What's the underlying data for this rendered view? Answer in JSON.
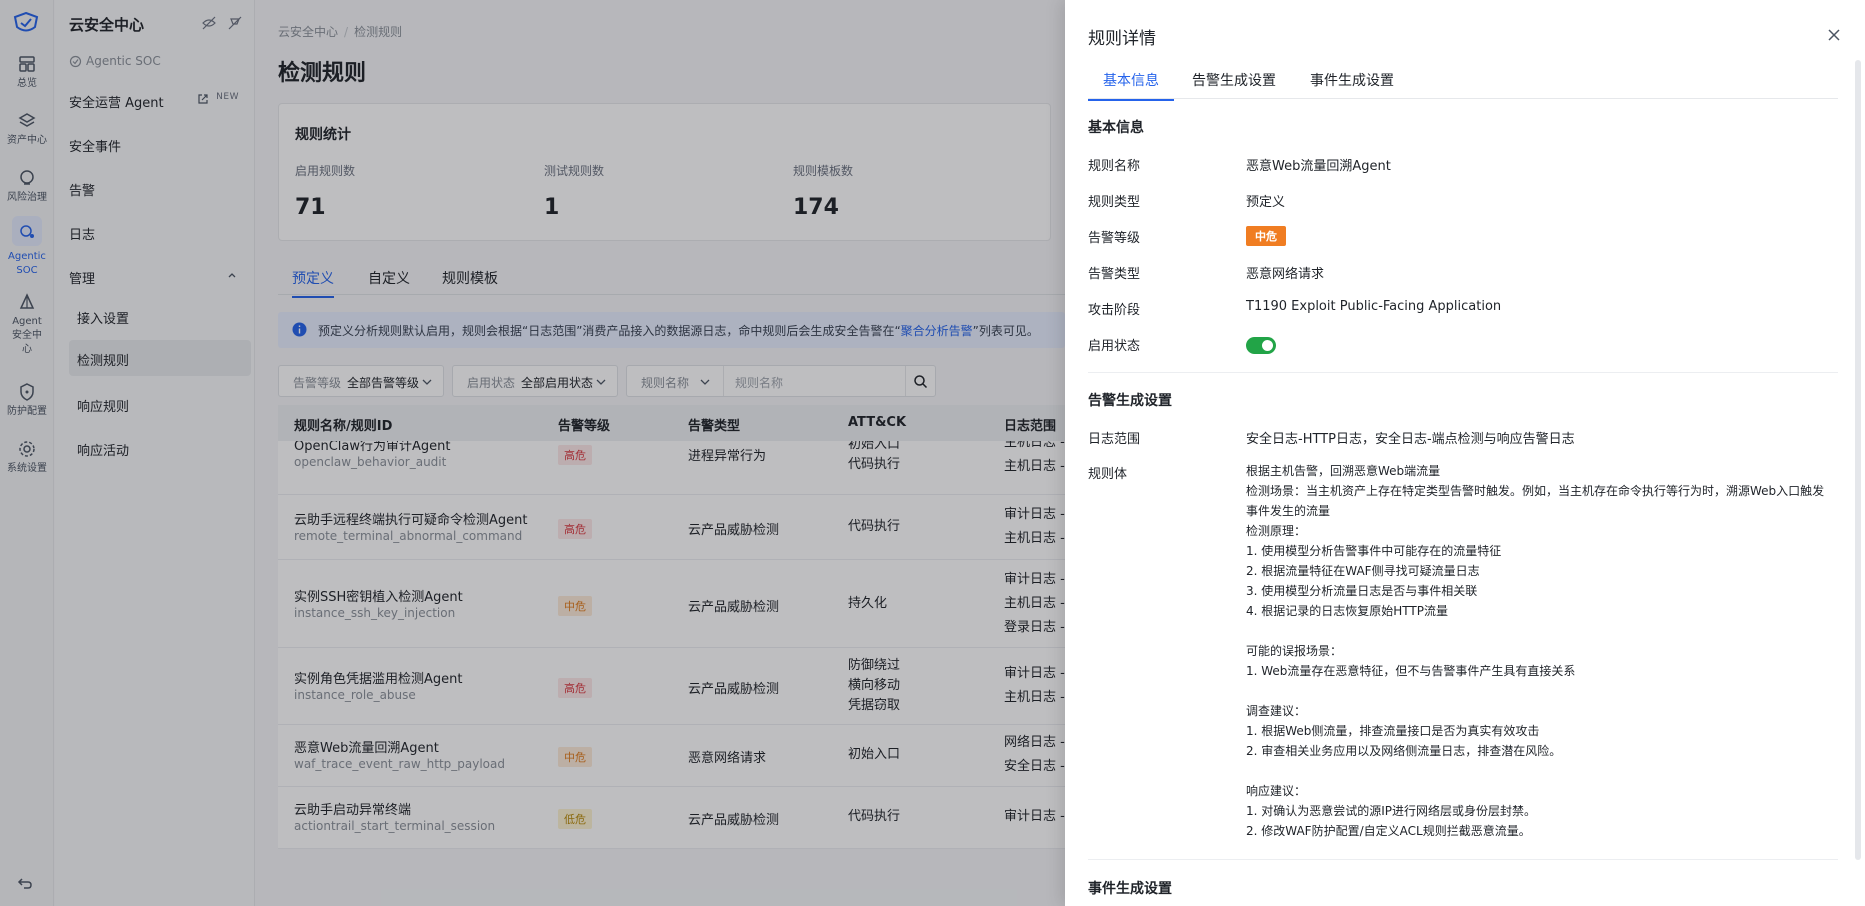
{
  "rail": {
    "items": [
      {
        "label": "总览",
        "icon": "dashboard-icon"
      },
      {
        "label": "资产中心",
        "icon": "layers-icon"
      },
      {
        "label": "风险治理",
        "icon": "risk-icon"
      },
      {
        "label": "Agentic SOC",
        "icon": "soc-icon"
      },
      {
        "label": "Agent 安全中心",
        "icon": "agent-icon"
      },
      {
        "label": "防护配置",
        "icon": "shield-icon"
      },
      {
        "label": "系统设置",
        "icon": "gear-icon"
      }
    ]
  },
  "subnav": {
    "brand": "云安全中心",
    "soc_tag": "Agentic SOC",
    "items": [
      {
        "label": "安全运营 Agent",
        "badge": "NEW"
      },
      {
        "label": "安全事件"
      },
      {
        "label": "告警"
      },
      {
        "label": "日志"
      },
      {
        "label": "管理"
      }
    ],
    "children": [
      {
        "label": "接入设置"
      },
      {
        "label": "检测规则"
      },
      {
        "label": "响应规则"
      },
      {
        "label": "响应活动"
      }
    ]
  },
  "main": {
    "breadcrumb": [
      "云安全中心",
      "检测规则"
    ],
    "title": "检测规则",
    "stats": {
      "title": "规则统计",
      "items": [
        {
          "label": "启用规则数",
          "value": "71"
        },
        {
          "label": "测试规则数",
          "value": "1"
        },
        {
          "label": "规则模板数",
          "value": "174"
        }
      ]
    },
    "tabs": [
      "预定义",
      "自定义",
      "规则模板"
    ],
    "banner": {
      "text_before": "预定义分析规则默认启用，规则会根据“日志范围”消费产品接入的数据源日志，命中规则后会生成安全告警在“",
      "link": "聚合分析告警",
      "text_after": "”列表可见。"
    },
    "filters": {
      "level_label": "告警等级",
      "level_value": "全部告警等级",
      "status_label": "启用状态",
      "status_value": "全部启用状态",
      "name_label": "规则名称",
      "name_placeholder": "规则名称"
    },
    "table": {
      "headers": [
        "规则名称/规则ID",
        "告警等级",
        "告警类型",
        "ATT&CK",
        "日志范围"
      ],
      "rows": [
        {
          "name": "OpenClaw行为审计Agent",
          "id": "openclaw_behavior_audit",
          "level": "高危",
          "type": "进程异常行为",
          "attck": [
            "初始入口",
            "代码执行"
          ],
          "logs": [
            "主机日志 -",
            "主机日志 -"
          ]
        },
        {
          "name": "云助手远程终端执行可疑命令检测Agent",
          "id": "remote_terminal_abnormal_command",
          "level": "高危",
          "type": "云产品威胁检测",
          "attck": [
            "代码执行"
          ],
          "logs": [
            "审计日志 -",
            "主机日志 -"
          ]
        },
        {
          "name": "实例SSH密钥植入检测Agent",
          "id": "instance_ssh_key_injection",
          "level": "中危",
          "type": "云产品威胁检测",
          "attck": [
            "持久化"
          ],
          "logs": [
            "审计日志 -",
            "主机日志 -",
            "登录日志 -"
          ]
        },
        {
          "name": "实例角色凭据滥用检测Agent",
          "id": "instance_role_abuse",
          "level": "高危",
          "type": "云产品威胁检测",
          "attck": [
            "防御绕过",
            "横向移动",
            "凭据窃取"
          ],
          "logs": [
            "审计日志 -",
            "主机日志 -"
          ]
        },
        {
          "name": "恶意Web流量回溯Agent",
          "id": "waf_trace_event_raw_http_payload",
          "level": "中危",
          "type": "恶意网络请求",
          "attck": [
            "初始入口"
          ],
          "logs": [
            "网络日志 -",
            "安全日志 -"
          ]
        },
        {
          "name": "云助手启动异常终端",
          "id": "actiontrail_start_terminal_session",
          "level": "低危",
          "type": "云产品威胁检测",
          "attck": [
            "代码执行"
          ],
          "logs": [
            "审计日志 -"
          ]
        }
      ]
    }
  },
  "drawer": {
    "title": "规则详情",
    "tabs": [
      "基本信息",
      "告警生成设置",
      "事件生成设置"
    ],
    "basic": {
      "section": "基本信息",
      "fields": [
        {
          "label": "规则名称",
          "value": "恶意Web流量回溯Agent"
        },
        {
          "label": "规则类型",
          "value": "预定义"
        },
        {
          "label": "告警等级",
          "value": "中危"
        },
        {
          "label": "告警类型",
          "value": "恶意网络请求"
        },
        {
          "label": "攻击阶段",
          "value": "T1190 Exploit Public-Facing Application"
        },
        {
          "label": "启用状态",
          "value": ""
        }
      ]
    },
    "alert": {
      "section": "告警生成设置",
      "log_scope_label": "日志范围",
      "log_scope_value": "安全日志-HTTP日志，安全日志-端点检测与响应告警日志",
      "rule_body_label": "规则体",
      "rule_body_lines": [
        "根据主机告警，回溯恶意Web端流量",
        "检测场景：当主机资产上存在特定类型告警时触发。例如，当主机存在命令执行等行为时，溯源Web入口触发",
        "事件发生的流量",
        "检测原理：",
        "1. 使用模型分析告警事件中可能存在的流量特征",
        "2. 根据流量特征在WAF侧寻找可疑流量日志",
        "3. 使用模型分析流量日志是否与事件相关联",
        "4. 根据记录的日志恢复原始HTTP流量",
        "",
        "可能的误报场景：",
        "1. Web流量存在恶意特征，但不与告警事件产生具有直接关系",
        "",
        "调查建议：",
        "1. 根据Web侧流量，排查流量接口是否为真实有效攻击",
        "2. 审查相关业务应用以及网络侧流量日志，排查潜在风险。",
        "",
        "响应建议：",
        "1. 对确认为恶意尝试的源IP进行网络层或身份层封禁。",
        "2. 修改WAF防护配置/自定义ACL规则拦截恶意流量。"
      ]
    },
    "event": {
      "section": "事件生成设置"
    }
  }
}
